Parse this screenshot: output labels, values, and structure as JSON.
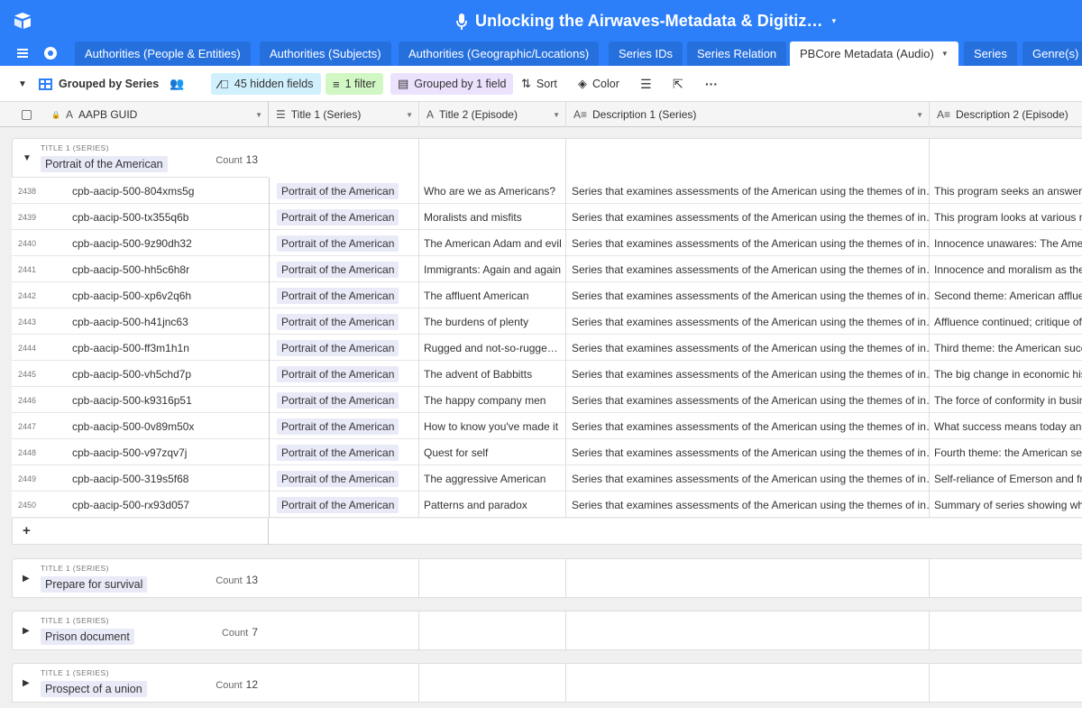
{
  "app": {
    "title": "Unlocking the Airwaves-Metadata & Digitiz…",
    "caret": "▾"
  },
  "tabs": [
    {
      "label": "Authorities (People & Entities)"
    },
    {
      "label": "Authorities (Subjects)"
    },
    {
      "label": "Authorities (Geographic/Locations)"
    },
    {
      "label": "Series IDs"
    },
    {
      "label": "Series Relation"
    },
    {
      "label": "PBCore Metadata (Audio)",
      "active": true
    },
    {
      "label": "Series"
    },
    {
      "label": "Genre(s)"
    }
  ],
  "viewbar": {
    "view_name": "Grouped by Series",
    "hidden_fields": "45 hidden fields",
    "filter": "1 filter",
    "grouped": "Grouped by 1 field",
    "sort": "Sort",
    "color": "Color"
  },
  "columns": {
    "primary": "AAPB GUID",
    "title1": "Title 1 (Series)",
    "title2": "Title 2 (Episode)",
    "desc1": "Description 1 (Series)",
    "desc2": "Description 2 (Episode)"
  },
  "group_label": "TITLE 1 (SERIES)",
  "count_label": "Count",
  "groups": [
    {
      "name": "Portrait of the American",
      "count": "13",
      "expanded": true
    },
    {
      "name": "Prepare for survival",
      "count": "13",
      "expanded": false
    },
    {
      "name": "Prison document",
      "count": "7",
      "expanded": false
    },
    {
      "name": "Prospect of a union",
      "count": "12",
      "expanded": false
    }
  ],
  "rows": [
    {
      "num": "2438",
      "guid": "cpb-aacip-500-804xms5g",
      "title1": "Portrait of the American",
      "title2": "Who are we as Americans?",
      "desc1": "Series that examines assessments of the American using the themes of in…",
      "desc2": "This program seeks an answer t"
    },
    {
      "num": "2439",
      "guid": "cpb-aacip-500-tx355q6b",
      "title1": "Portrait of the American",
      "title2": "Moralists and misfits",
      "desc1": "Series that examines assessments of the American using the themes of in…",
      "desc2": "This program looks at various m"
    },
    {
      "num": "2440",
      "guid": "cpb-aacip-500-9z90dh32",
      "title1": "Portrait of the American",
      "title2": "The American Adam and evil",
      "desc1": "Series that examines assessments of the American using the themes of in…",
      "desc2": "Innocence unawares: The Ameri"
    },
    {
      "num": "2441",
      "guid": "cpb-aacip-500-hh5c6h8r",
      "title1": "Portrait of the American",
      "title2": "Immigrants: Again and again",
      "desc1": "Series that examines assessments of the American using the themes of in…",
      "desc2": "Innocence and moralism as they"
    },
    {
      "num": "2442",
      "guid": "cpb-aacip-500-xp6v2q6h",
      "title1": "Portrait of the American",
      "title2": "The affluent American",
      "desc1": "Series that examines assessments of the American using the themes of in…",
      "desc2": "Second theme: American affluen"
    },
    {
      "num": "2443",
      "guid": "cpb-aacip-500-h41jnc63",
      "title1": "Portrait of the American",
      "title2": "The burdens of plenty",
      "desc1": "Series that examines assessments of the American using the themes of in…",
      "desc2": "Affluence continued; critique of"
    },
    {
      "num": "2444",
      "guid": "cpb-aacip-500-ff3m1h1n",
      "title1": "Portrait of the American",
      "title2": "Rugged and not-so-rugge…",
      "desc1": "Series that examines assessments of the American using the themes of in…",
      "desc2": "Third theme: the American succ"
    },
    {
      "num": "2445",
      "guid": "cpb-aacip-500-vh5chd7p",
      "title1": "Portrait of the American",
      "title2": "The advent of Babbitts",
      "desc1": "Series that examines assessments of the American using the themes of in…",
      "desc2": "The big change in economic his"
    },
    {
      "num": "2446",
      "guid": "cpb-aacip-500-k9316p51",
      "title1": "Portrait of the American",
      "title2": "The happy company men",
      "desc1": "Series that examines assessments of the American using the themes of in…",
      "desc2": "The force of conformity in busin"
    },
    {
      "num": "2447",
      "guid": "cpb-aacip-500-0v89m50x",
      "title1": "Portrait of the American",
      "title2": "How to know you've made it",
      "desc1": "Series that examines assessments of the American using the themes of in…",
      "desc2": "What success means today and"
    },
    {
      "num": "2448",
      "guid": "cpb-aacip-500-v97zqv7j",
      "title1": "Portrait of the American",
      "title2": "Quest for self",
      "desc1": "Series that examines assessments of the American using the themes of in…",
      "desc2": "Fourth theme: the American sel"
    },
    {
      "num": "2449",
      "guid": "cpb-aacip-500-319s5f68",
      "title1": "Portrait of the American",
      "title2": "The aggressive American",
      "desc1": "Series that examines assessments of the American using the themes of in…",
      "desc2": "Self-reliance of Emerson and fro"
    },
    {
      "num": "2450",
      "guid": "cpb-aacip-500-rx93d057",
      "title1": "Portrait of the American",
      "title2": "Patterns and paradox",
      "desc1": "Series that examines assessments of the American using the themes of in…",
      "desc2": "Summary of series showing wha"
    }
  ],
  "colors": {
    "brand": "#2d7ff9",
    "hidden_chip": "#d0f0fd",
    "filter_chip": "#d1f7c4",
    "group_chip": "#ede2fe",
    "link_chip": "#e9eaf8"
  }
}
